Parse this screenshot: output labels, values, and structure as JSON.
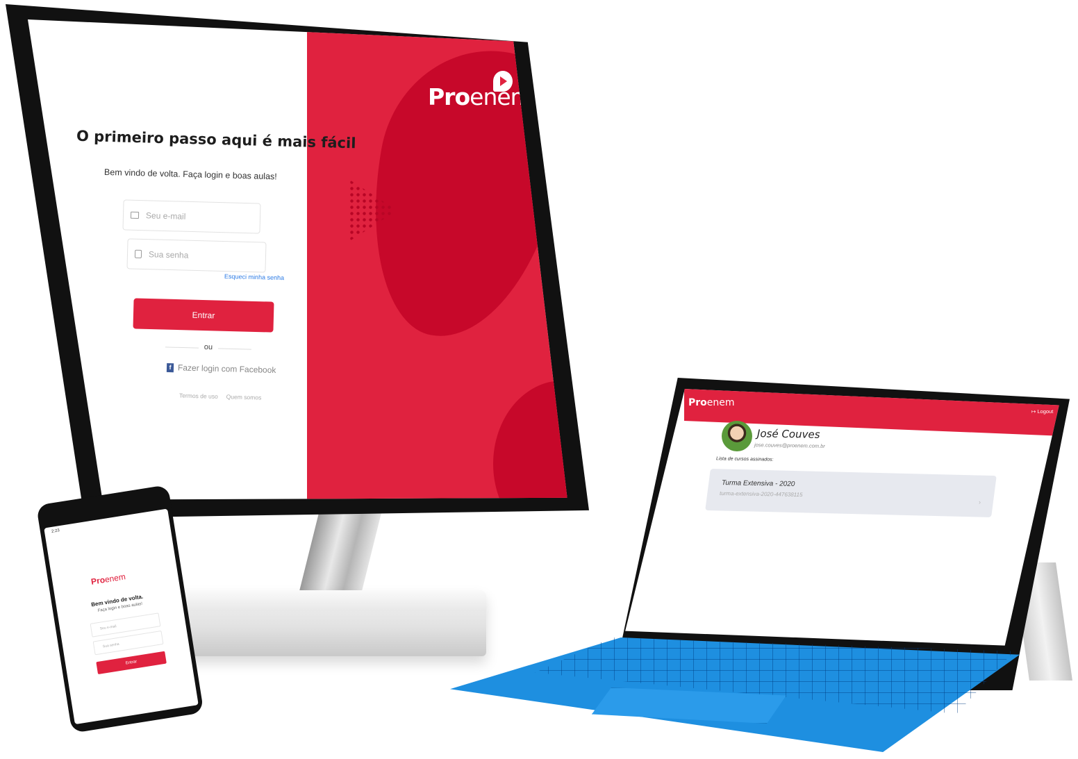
{
  "brand": {
    "logo_bold": "Pro",
    "logo_light": "enem",
    "primary_color": "#e0223f",
    "dark_color": "#c7082a"
  },
  "desktop_login": {
    "title": "O primeiro passo aqui é mais fácil",
    "subtitle": "Bem vindo de volta. Faça login e boas aulas!",
    "email_placeholder": "Seu e-mail",
    "password_placeholder": "Sua senha",
    "forgot_password": "Esqueci minha senha",
    "submit_label": "Entrar",
    "divider": "ou",
    "facebook_label": "Fazer login com Facebook",
    "terms_link": "Termos de uso",
    "about_link": "Quem somos"
  },
  "tablet_profile": {
    "logout_label": "Logout",
    "user_name": "José Couves",
    "user_email": "jose.couves@proenem.com.br",
    "list_label": "Lista de cursos assinados:",
    "courses": [
      {
        "name": "Turma Extensiva - 2020",
        "id": "turma-extensiva-2020-447638115"
      }
    ]
  },
  "phone_login": {
    "status_time": "2:23",
    "welcome": "Bem vindo de volta.",
    "subtitle": "Faça login e boas aulas!",
    "email_placeholder": "Seu e-mail",
    "password_placeholder": "Sua senha",
    "submit_label": "Entrar"
  }
}
